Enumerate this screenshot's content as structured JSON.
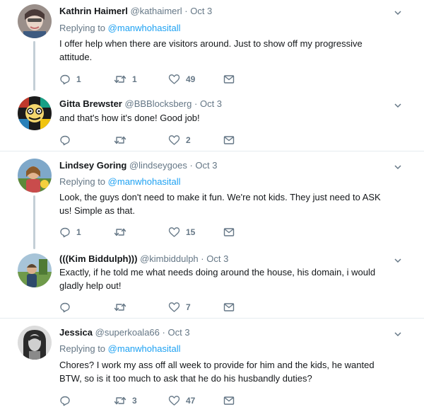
{
  "tweets": [
    {
      "name": "Kathrin Haimerl",
      "handle": "@kathaimerl",
      "date": "Oct 3",
      "replying_label": "Replying to",
      "replying_to": "@manwhohasitall",
      "text": "I offer help when there are visitors around. Just to show off my progressive attitude.",
      "replies": "1",
      "retweets": "1",
      "likes": "49"
    },
    {
      "name": "Gitta Brewster",
      "handle": "@BBBlocksberg",
      "date": "Oct 3",
      "text": "and that's how it's done! Good job!",
      "replies": "",
      "retweets": "",
      "likes": "2"
    },
    {
      "name": "Lindsey Goring",
      "handle": "@lindseygoes",
      "date": "Oct 3",
      "replying_label": "Replying to",
      "replying_to": "@manwhohasitall",
      "text": "Look, the guys don't need to make it fun. We're not kids. They just need to ASK us! Simple as that.",
      "replies": "1",
      "retweets": "",
      "likes": "15"
    },
    {
      "name": "(((Kim Biddulph)))",
      "handle": "@kimbiddulph",
      "date": "Oct 3",
      "text": "Exactly, if he told me what needs doing around the house, his domain, i would gladly help out!",
      "replies": "",
      "retweets": "",
      "likes": "7"
    },
    {
      "name": "Jessica",
      "handle": "@superkoala66",
      "date": "Oct 3",
      "replying_label": "Replying to",
      "replying_to": "@manwhohasitall",
      "text": "Chores? I work my ass off all week to provide for him and the kids, he wanted BTW, so is it too much to ask that he do his husbandly duties?",
      "replies": "",
      "retweets": "3",
      "likes": "47"
    }
  ],
  "colors": {
    "link": "#1da1f2",
    "meta": "#657786",
    "separator": "#e6ecf0",
    "thread_line": "#c4cfd6"
  },
  "icons": [
    "chevron-down-icon",
    "reply-icon",
    "retweet-icon",
    "like-icon",
    "direct-message-icon"
  ]
}
